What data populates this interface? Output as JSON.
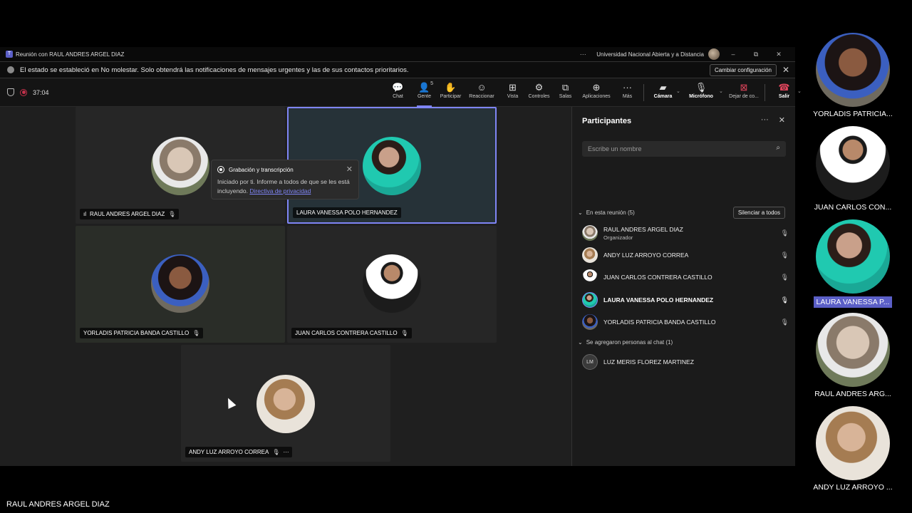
{
  "window": {
    "title": "Reunión con RAUL ANDRES ARGEL DIAZ",
    "org": "Universidad Nacional Abierta y a Distancia",
    "more_icon": "ellipsis-icon",
    "minimize": "–",
    "restore": "⧉",
    "close": "✕"
  },
  "notice": {
    "text": "El estado se estableció en No molestar. Solo obtendrá las notificaciones de mensajes urgentes y las de sus contactos prioritarios.",
    "button": "Cambiar configuración",
    "close": "✕"
  },
  "toolbar": {
    "timer": "37:04",
    "people_count": "5",
    "items": [
      {
        "label": "Chat",
        "icon": "💬"
      },
      {
        "label": "Gente",
        "icon": "👤"
      },
      {
        "label": "Participar",
        "icon": "✋"
      },
      {
        "label": "Reaccionar",
        "icon": "☺"
      },
      {
        "label": "Vista",
        "icon": "⊞"
      },
      {
        "label": "Controles",
        "icon": "⚙"
      },
      {
        "label": "Salas",
        "icon": "⧉"
      },
      {
        "label": "Aplicaciones",
        "icon": "⊕"
      },
      {
        "label": "Más",
        "icon": "···"
      }
    ],
    "camera": {
      "label": "Cámara",
      "icon": "▰"
    },
    "mic": {
      "label": "Micrófono",
      "icon": "🎙"
    },
    "share": {
      "label": "Dejar de co...",
      "icon": "⊠"
    },
    "leave": {
      "label": "Salir",
      "icon": "☎"
    }
  },
  "tiles": [
    {
      "name": "RAUL ANDRES ARGEL DIAZ",
      "signal": "ıl",
      "mic": "🎙"
    },
    {
      "name": "LAURA VANESSA POLO HERNANDEZ"
    },
    {
      "name": "YORLADIS PATRICIA BANDA CASTILLO",
      "mic": "🎙"
    },
    {
      "name": "JUAN CARLOS CONTRERA CASTILLO",
      "mic": "🎙"
    },
    {
      "name": "ANDY LUZ ARROYO CORREA",
      "mic": "🎙",
      "more": "···"
    }
  ],
  "popup": {
    "title": "Grabación y transcripción",
    "body": "Iniciado por ti. Informe a todos de que se les está incluyendo.",
    "link": "Directiva de privacidad",
    "close": "✕"
  },
  "panel": {
    "title": "Participantes",
    "more": "···",
    "close": "✕",
    "search_placeholder": "Escribe un nombre",
    "search_icon": "⌕",
    "in_meeting": "En esta reunión (5)",
    "mute_all": "Silenciar a todos",
    "participants": [
      {
        "name": "RAUL ANDRES ARGEL DIAZ",
        "role": "Organizador",
        "mic": "🎙"
      },
      {
        "name": "ANDY LUZ ARROYO CORREA",
        "mic": "🎙"
      },
      {
        "name": "JUAN CARLOS CONTRERA CASTILLO",
        "mic": "🎙"
      },
      {
        "name": "LAURA VANESSA POLO HERNANDEZ",
        "mic": "🎙"
      },
      {
        "name": "YORLADIS PATRICIA BANDA CASTILLO",
        "mic": "🎙"
      }
    ],
    "chat_section": "Se agregaron personas al chat (1)",
    "chat_people": [
      {
        "name": "LUZ MERIS FLOREZ MARTINEZ",
        "initials": "LM"
      }
    ],
    "chevron": "⌄"
  },
  "right_gallery": [
    {
      "name": "YORLADIS PATRICIA..."
    },
    {
      "name": "JUAN CARLOS CON..."
    },
    {
      "name": "LAURA VANESSA P..."
    },
    {
      "name": "RAUL ANDRES ARG..."
    },
    {
      "name": "ANDY LUZ ARROYO ..."
    }
  ],
  "footer": "RAUL ANDRES ARGEL DIAZ",
  "colors": {
    "accent": "#7f85f5",
    "record": "#c4314b",
    "highlight": "#5b5fc7"
  }
}
